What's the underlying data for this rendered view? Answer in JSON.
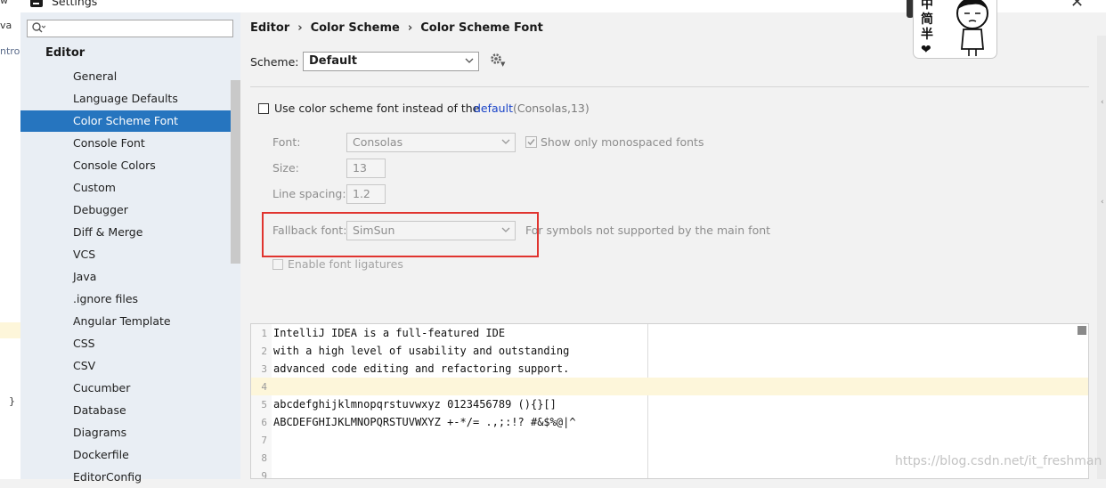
{
  "window": {
    "title": "Settings"
  },
  "editor_fragments": {
    "top1": "w",
    "top2": "va",
    "top3": "ntro",
    "brace": "}"
  },
  "sidebar": {
    "search_placeholder": "",
    "root": "Editor",
    "selected": "Color Scheme Font",
    "items": [
      "General",
      "Language Defaults",
      "Color Scheme Font",
      "Console Font",
      "Console Colors",
      "Custom",
      "Debugger",
      "Diff & Merge",
      "VCS",
      "Java",
      ".ignore files",
      "Angular Template",
      "CSS",
      "CSV",
      "Cucumber",
      "Database",
      "Diagrams",
      "Dockerfile",
      "EditorConfig"
    ]
  },
  "breadcrumb": [
    "Editor",
    "Color Scheme",
    "Color Scheme Font"
  ],
  "scheme": {
    "label": "Scheme:",
    "value": "Default"
  },
  "use_scheme_font": {
    "label": "Use color scheme font instead of the",
    "link": "default",
    "detail": "(Consolas,13)",
    "checked": false
  },
  "font": {
    "label": "Font:",
    "value": "Consolas",
    "mono_label": "Show only monospaced fonts",
    "mono_checked": true
  },
  "size": {
    "label": "Size:",
    "value": "13"
  },
  "line_spacing": {
    "label": "Line spacing:",
    "value": "1.2"
  },
  "fallback": {
    "label": "Fallback font:",
    "value": "SimSun",
    "hint": "For symbols not supported by the main font"
  },
  "ligatures": {
    "label": "Enable font ligatures",
    "checked": false
  },
  "preview": {
    "lines": [
      {
        "n": "1",
        "text": "IntelliJ IDEA is a full-featured IDE"
      },
      {
        "n": "2",
        "text": "with a high level of usability and outstanding"
      },
      {
        "n": "3",
        "text": "advanced code editing and refactoring support."
      },
      {
        "n": "4",
        "text": ""
      },
      {
        "n": "5",
        "text": "abcdefghijklmnopqrstuvwxyz 0123456789 (){}[]"
      },
      {
        "n": "6",
        "text": "ABCDEFGHIJKLMNOPQRSTUVWXYZ +-*/= .,;:!? #&$%@|^"
      },
      {
        "n": "7",
        "text": ""
      },
      {
        "n": "8",
        "text": ""
      },
      {
        "n": "9",
        "text": ""
      }
    ],
    "current_line": "4"
  },
  "sticker": {
    "chars": [
      "中",
      "简",
      "半",
      "❤"
    ]
  },
  "watermark": "https://blog.csdn.net/it_freshman",
  "colors": {
    "selection": "#2675bf",
    "highlight_box": "#e0342f",
    "link": "#1a44c8"
  },
  "icons": {
    "search": "search-icon",
    "gear": "gear-icon",
    "close": "close-icon",
    "dropdown": "chevron-down-icon"
  }
}
